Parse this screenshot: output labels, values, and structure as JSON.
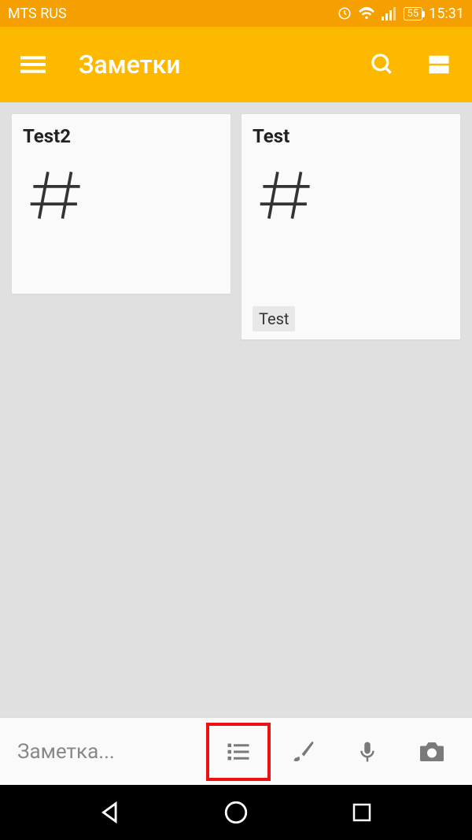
{
  "status": {
    "carrier": "MTS RUS",
    "battery": "55",
    "time": "15:31"
  },
  "appbar": {
    "title": "Заметки"
  },
  "notes": [
    {
      "title": "Test2",
      "labels": []
    },
    {
      "title": "Test",
      "labels": [
        "Test"
      ]
    }
  ],
  "input": {
    "placeholder": "Заметка..."
  }
}
